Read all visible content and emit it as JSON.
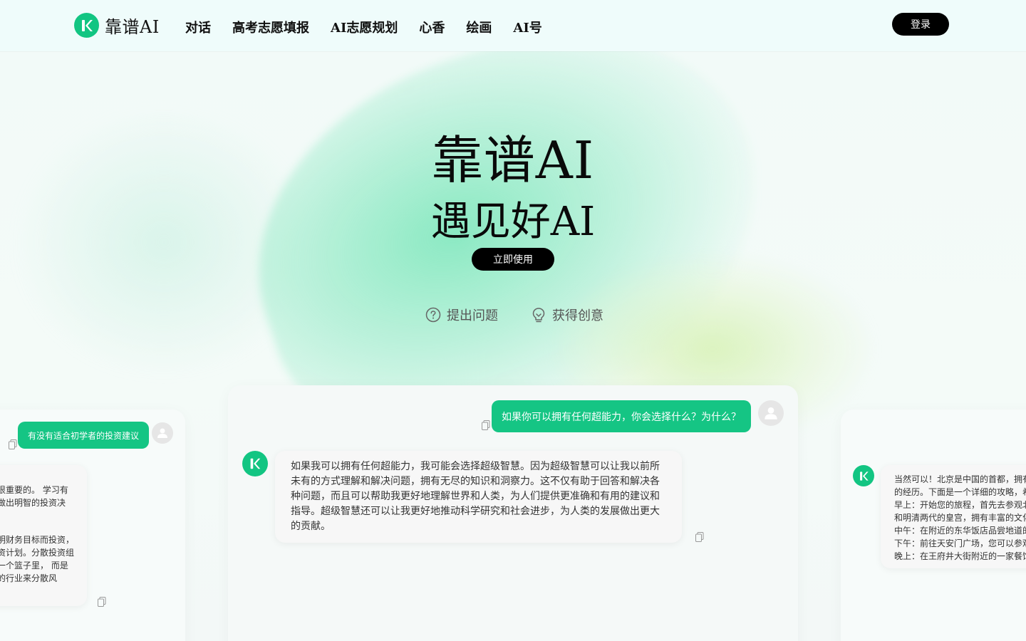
{
  "header": {
    "logo_text": "靠谱AI",
    "nav": [
      "对话",
      "高考志愿填报",
      "AI志愿规划",
      "心香",
      "绘画",
      "AI号"
    ],
    "login_label": "登录"
  },
  "hero": {
    "title": "靠谱AI",
    "subtitle": "遇见好AI",
    "cta_label": "立即使用",
    "features": [
      {
        "label": "提出问题",
        "icon": "question-circle-icon"
      },
      {
        "label": "获得创意",
        "icon": "lightbulb-icon"
      }
    ]
  },
  "cards": {
    "left": {
      "user_message": "有没有适合初学者的投资建议",
      "bot_lines": [
        "很重要的。 学习有",
        "做出明智的投资决",
        "",
        "",
        "明财务目标而投资，",
        "资计划。分散投资组",
        "一个篮子里， 而是",
        "的行业来分散风"
      ]
    },
    "center": {
      "user_message": "如果你可以拥有任何超能力，你会选择什么？为什么？",
      "bot_message": "如果我可以拥有任何超能力，我可能会选择超级智慧。因为超级智慧可以让我以前所未有的方式理解和解决问题，拥有无尽的知识和洞察力。这不仅有助于回答和解决各种问题，而且可以帮助我更好地理解世界和人类，为人们提供更准确和有用的建议和指导。超级智慧还可以让我更好地推动科学研究和社会进步，为人类的发展做出更大的贡献。"
    },
    "right": {
      "bot_lines": [
        "当然可以！北京是中国的首都，拥有",
        "的经历。下面是一个详细的攻略，希",
        "早上：开始您的旅程，首先去参观北",
        "和明清两代的皇宫，拥有丰富的文化",
        "中午：在附近的东华饭店品尝地道的",
        "下午：前往天安门广场，您可以参观",
        "晚上：在王府井大街附近的一家餐馆"
      ]
    }
  },
  "colors": {
    "accent": "#12c582",
    "bubble_green": "#15c584",
    "dark": "#000000"
  }
}
